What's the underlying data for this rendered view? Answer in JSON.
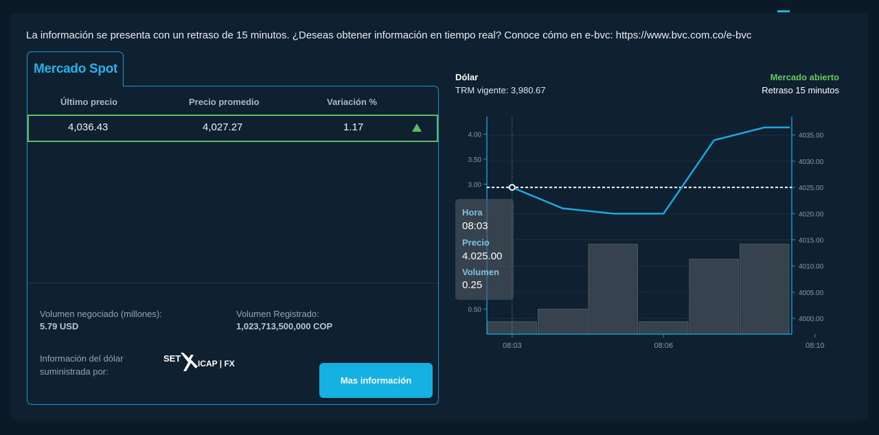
{
  "notice": "La información se presenta con un retraso de 15 minutos. ¿Deseas obtener información en tiempo real? Conoce cómo en e-bvc: https://www.bvc.com.co/e-bvc",
  "tab": {
    "label": "Mercado Spot"
  },
  "table": {
    "headers": [
      "Último precio",
      "Precio promedio",
      "Variación %"
    ],
    "row": {
      "last_price": "4,036.43",
      "avg_price": "4,027.27",
      "variation": "1.17",
      "trend_icon": "up-triangle-icon",
      "trend_color": "#5bbd5f"
    }
  },
  "info": {
    "volume_traded_label": "Volumen negociado (millones):",
    "volume_traded_value": "5.79 USD",
    "volume_registered_label": "Volumen Registrado:",
    "volume_registered_value": "1,023,713,500,000 COP",
    "supplier_label_line1": "Información del dólar",
    "supplier_label_line2": "suministrada por:",
    "logo_text_left": "SET",
    "logo_text_right": "ICAP | FX"
  },
  "button": {
    "label": "Mas información"
  },
  "chart_header": {
    "title": "Dólar",
    "trm": "TRM vigente: 3,980.67",
    "market_status": "Mercado abierto",
    "delay": "Retraso 15 minutos"
  },
  "tooltip": {
    "hora_label": "Hora",
    "hora_value": "08:03",
    "precio_label": "Precio",
    "precio_value": "4.025.00",
    "volumen_label": "Volumen",
    "volumen_value": "0.25"
  },
  "colors": {
    "accent": "#14b0e2",
    "positive": "#5bbd5f",
    "border": "#1b96cc"
  },
  "chart_data": {
    "type": "line+bar",
    "left_axis": {
      "ticks": [
        "4.00",
        "3.50",
        "3.00",
        "0.50"
      ],
      "tick_values": [
        4.0,
        3.5,
        3.0,
        0.5
      ],
      "range": [
        0,
        4.35
      ]
    },
    "right_axis": {
      "ticks": [
        "4035.00",
        "4030.00",
        "4025.00",
        "4020.00",
        "4015.00",
        "4010.00",
        "4005.00",
        "4000.00"
      ],
      "tick_values": [
        4035,
        4030,
        4025,
        4020,
        4015,
        4010,
        4005,
        4000
      ],
      "range": [
        3997,
        4038.5
      ]
    },
    "x_ticks": [
      "08:03",
      "08:06",
      "08:10"
    ],
    "x_tick_positions": [
      0,
      3,
      6
    ],
    "volume": {
      "x": [
        0,
        1,
        2,
        3,
        4,
        5
      ],
      "values": [
        0.25,
        0.5,
        1.8,
        0.25,
        1.5,
        1.8
      ]
    },
    "price": {
      "x": [
        0,
        1,
        2,
        3,
        4,
        5,
        5.5
      ],
      "values": [
        4025.0,
        4021.0,
        4020.0,
        4020.0,
        4034.0,
        4036.43,
        4036.43
      ]
    },
    "reference_line": 4025.0,
    "highlight_x": 0
  }
}
